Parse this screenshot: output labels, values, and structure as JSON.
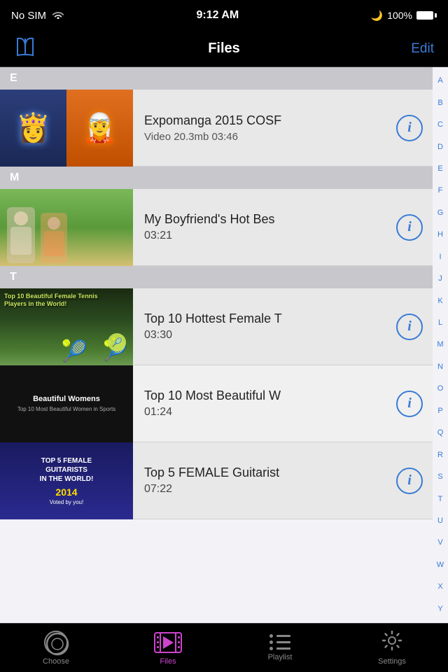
{
  "statusBar": {
    "carrier": "No SIM",
    "time": "9:12 AM",
    "battery": "100%",
    "moonIcon": "🌙"
  },
  "navBar": {
    "title": "Files",
    "editLabel": "Edit"
  },
  "alphabet": [
    "A",
    "B",
    "C",
    "D",
    "E",
    "F",
    "G",
    "H",
    "I",
    "J",
    "K",
    "L",
    "M",
    "N",
    "O",
    "P",
    "Q",
    "R",
    "S",
    "T",
    "U",
    "V",
    "W",
    "X",
    "Y"
  ],
  "sections": [
    {
      "letter": "E",
      "items": [
        {
          "id": "expomanga",
          "title": "Expomanga 2015 COSF",
          "meta": "Video  20.3mb  03:46",
          "duration": ""
        }
      ]
    },
    {
      "letter": "M",
      "items": [
        {
          "id": "boyfriend",
          "title": "My Boyfriend's Hot Bes",
          "meta": "",
          "duration": "03:21"
        }
      ]
    },
    {
      "letter": "T",
      "items": [
        {
          "id": "tennis",
          "title": "Top 10 Hottest Female T",
          "meta": "",
          "duration": "03:30"
        },
        {
          "id": "beautiful",
          "title": "Top 10 Most Beautiful W",
          "meta": "",
          "duration": "01:24"
        },
        {
          "id": "guitar",
          "title": "Top 5 FEMALE Guitarist",
          "meta": "",
          "duration": "07:22"
        }
      ]
    }
  ],
  "tabBar": {
    "tabs": [
      {
        "id": "choose",
        "label": "Choose",
        "active": false
      },
      {
        "id": "files",
        "label": "Files",
        "active": true
      },
      {
        "id": "playlist",
        "label": "Playlist",
        "active": false
      },
      {
        "id": "settings",
        "label": "Settings",
        "active": false
      }
    ]
  }
}
